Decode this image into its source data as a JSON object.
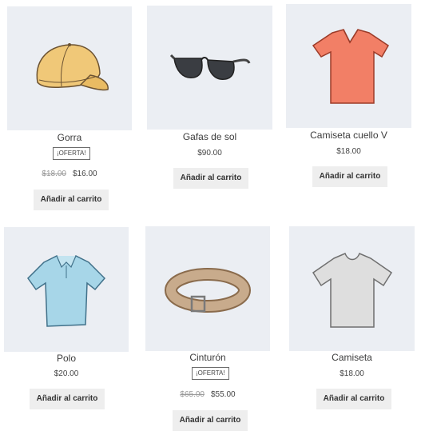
{
  "products": [
    {
      "title": "Gorra",
      "badge": "¡OFERTA!",
      "old_price": "$18.00",
      "price": "$16.00",
      "button": "Añadir al carrito",
      "image": "cap-image"
    },
    {
      "title": "Gafas de sol",
      "price": "$90.00",
      "button": "Añadir al carrito",
      "image": "sunglasses-image"
    },
    {
      "title": "Camiseta cuello V",
      "price": "$18.00",
      "button": "Añadir al carrito",
      "image": "vneck-shirt-image"
    },
    {
      "title": "Polo",
      "price": "$20.00",
      "button": "Añadir al carrito",
      "image": "polo-shirt-image"
    },
    {
      "title": "Cinturón",
      "badge": "¡OFERTA!",
      "old_price": "$65.00",
      "price": "$55.00",
      "button": "Añadir al carrito",
      "image": "belt-image"
    },
    {
      "title": "Camiseta",
      "price": "$18.00",
      "button": "Añadir al carrito",
      "image": "tshirt-image"
    }
  ],
  "colors": {
    "thumb_bg": "#ebeef3",
    "button_bg": "#eeeeee",
    "cap": "#f0c878",
    "vneck": "#f27f66",
    "polo": "#a7d6e8",
    "belt": "#c8ab8c",
    "tshirt": "#dedede"
  }
}
